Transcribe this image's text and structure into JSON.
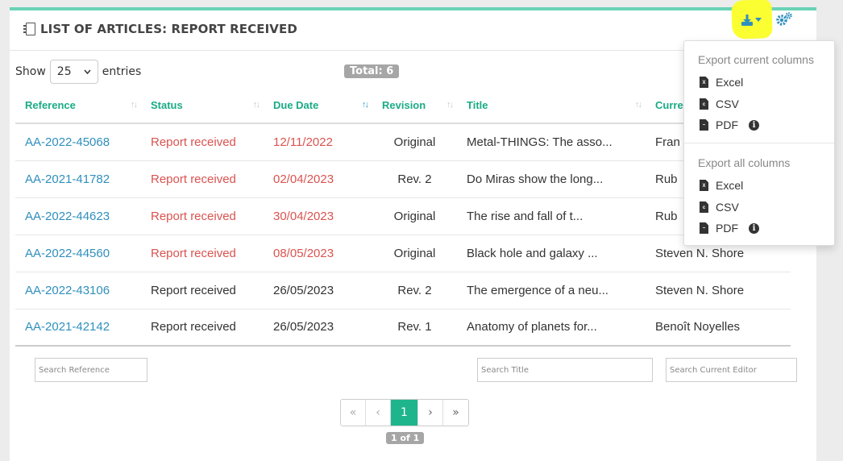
{
  "panel": {
    "title": "LIST OF ARTICLES: REPORT RECEIVED"
  },
  "controls": {
    "show_label": "Show",
    "entries_value": "25",
    "entries_label": "entries",
    "total": "Total: 6"
  },
  "table": {
    "columns": [
      "Reference",
      "Status",
      "Due Date",
      "Revision",
      "Title",
      "Current Editor"
    ],
    "rows": [
      {
        "reference": "AA-2022-45068",
        "status": "Report received",
        "due": "12/11/2022",
        "revision": "Original",
        "title": "Metal-THINGS: The asso...",
        "editor": "Fran",
        "overdue": true
      },
      {
        "reference": "AA-2021-41782",
        "status": "Report received",
        "due": "02/04/2023",
        "revision": "Rev. 2",
        "title": "Do Miras show the long...",
        "editor": "Rub",
        "overdue": true
      },
      {
        "reference": "AA-2022-44623",
        "status": "Report received",
        "due": "30/04/2023",
        "revision": "Original",
        "title": "The rise and fall of t...",
        "editor": "Rub",
        "overdue": true
      },
      {
        "reference": "AA-2022-44560",
        "status": "Report received",
        "due": "08/05/2023",
        "revision": "Original",
        "title": "Black hole and galaxy ...",
        "editor": "Steven N. Shore",
        "overdue": true
      },
      {
        "reference": "AA-2022-43106",
        "status": "Report received",
        "due": "26/05/2023",
        "revision": "Rev. 2",
        "title": "The emergence of a neu...",
        "editor": "Steven N. Shore",
        "overdue": false
      },
      {
        "reference": "AA-2021-42142",
        "status": "Report received",
        "due": "26/05/2023",
        "revision": "Rev. 1",
        "title": "Anatomy of planets for...",
        "editor": "Benoît Noyelles",
        "overdue": false
      }
    ]
  },
  "filters": {
    "reference_placeholder": "Search Reference",
    "title_placeholder": "Search Title",
    "editor_placeholder": "Search Current Editor"
  },
  "pagination": {
    "first": "«",
    "prev": "‹",
    "current": "1",
    "next": "›",
    "last": "»",
    "info": "1 of 1"
  },
  "export_menu": {
    "current_header": "Export current columns",
    "all_header": "Export all columns",
    "excel": "Excel",
    "csv": "CSV",
    "pdf": "PDF"
  },
  "colors": {
    "accent": "#1aab86",
    "link": "#2f8fbd",
    "overdue": "#d9534f",
    "highlight": "#fbff32"
  }
}
